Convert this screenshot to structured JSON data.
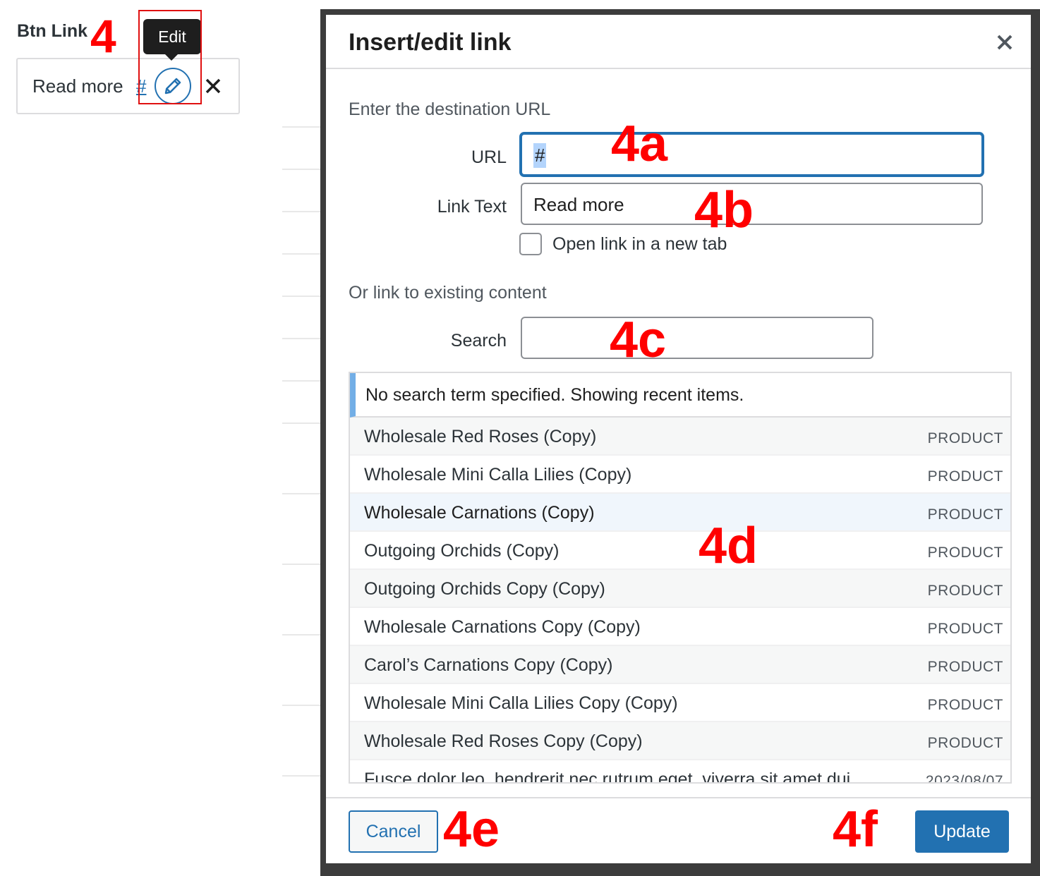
{
  "field": {
    "label": "Btn Link",
    "link_text": "Read more",
    "link_url": "#",
    "tooltip": "Edit",
    "icons": {
      "edit": "pencil-icon",
      "remove": "close-icon"
    }
  },
  "annotations": {
    "a4": "4",
    "a4a": "4a",
    "a4b": "4b",
    "a4c": "4c",
    "a4d": "4d",
    "a4e": "4e",
    "a4f": "4f",
    "color": "#ff0000"
  },
  "dialog": {
    "title": "Insert/edit link",
    "close_icon": "close-icon",
    "destination_heading": "Enter the destination URL",
    "url_label": "URL",
    "url_value": "#",
    "link_text_label": "Link Text",
    "link_text_value": "Read more",
    "new_tab_label": "Open link in a new tab",
    "new_tab_checked": false,
    "existing_heading": "Or link to existing content",
    "search_label": "Search",
    "search_value": "",
    "notice": "No search term specified. Showing recent items.",
    "results": [
      {
        "title": "Wholesale Red Roses (Copy)",
        "type": "PRODUCT"
      },
      {
        "title": "Wholesale Mini Calla Lilies (Copy)",
        "type": "PRODUCT"
      },
      {
        "title": "Wholesale Carnations (Copy)",
        "type": "PRODUCT"
      },
      {
        "title": "Outgoing Orchids (Copy)",
        "type": "PRODUCT"
      },
      {
        "title": "Outgoing Orchids Copy (Copy)",
        "type": "PRODUCT"
      },
      {
        "title": "Wholesale Carnations Copy (Copy)",
        "type": "PRODUCT"
      },
      {
        "title": "Carol’s Carnations Copy (Copy)",
        "type": "PRODUCT"
      },
      {
        "title": "Wholesale Mini Calla Lilies Copy (Copy)",
        "type": "PRODUCT"
      },
      {
        "title": "Wholesale Red Roses Copy (Copy)",
        "type": "PRODUCT"
      },
      {
        "title": "Fusce dolor leo, hendrerit nec rutrum eget, viverra sit amet dui",
        "type": "2023/08/07"
      }
    ],
    "cancel_label": "Cancel",
    "update_label": "Update",
    "colors": {
      "accent": "#2271b1",
      "notice_border": "#72aee6"
    }
  }
}
